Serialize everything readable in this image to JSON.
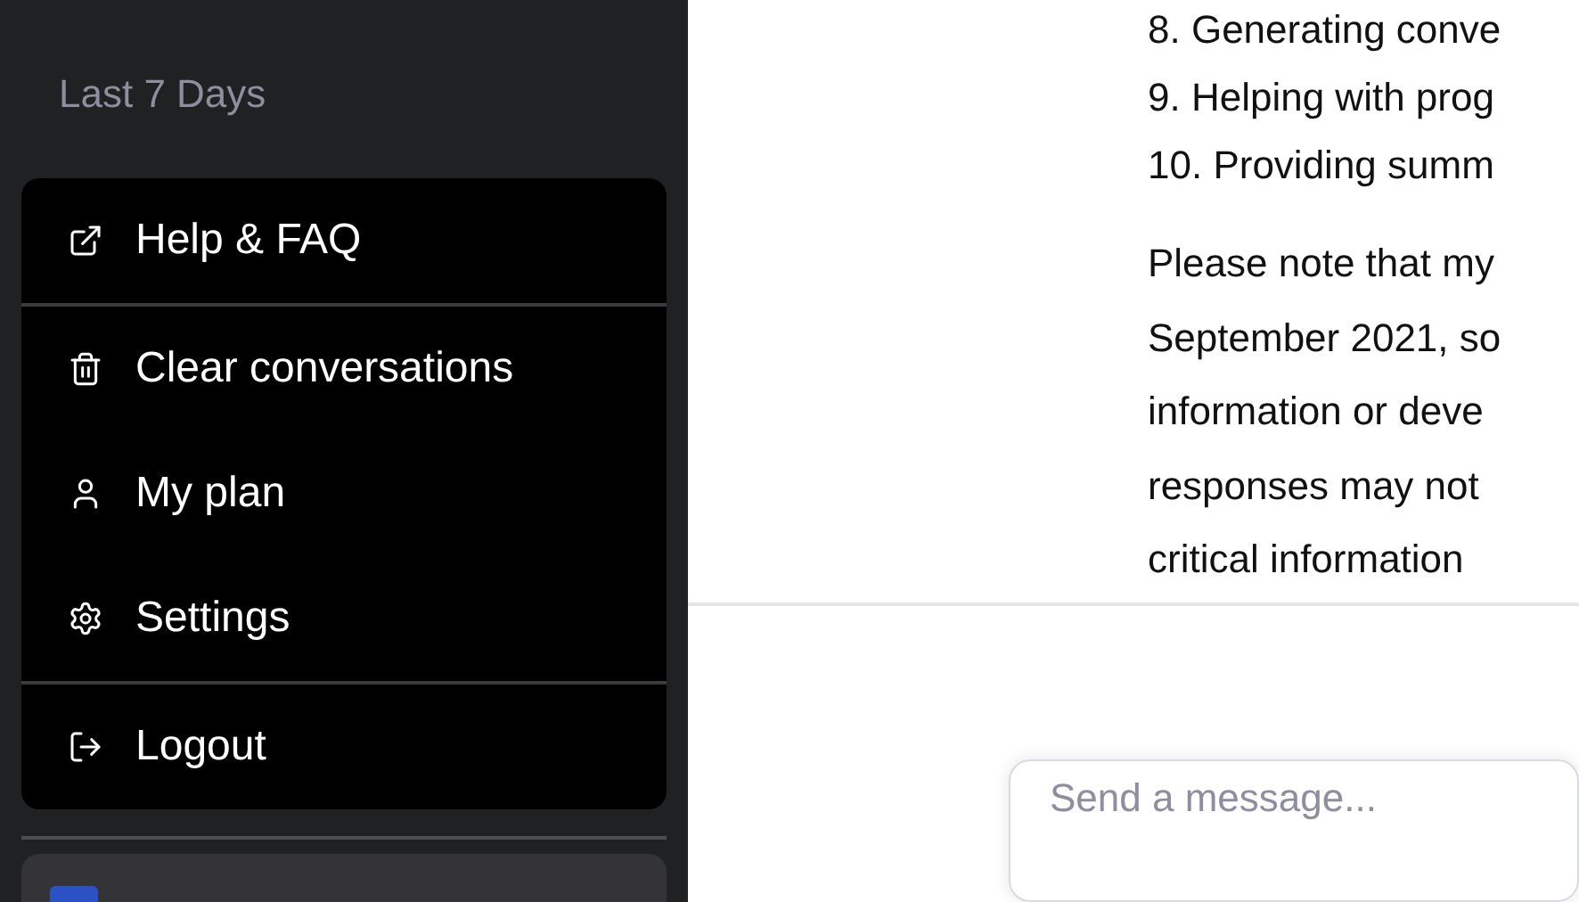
{
  "sidebar": {
    "section_title": "Last 7 Days",
    "menu": {
      "sections": [
        [
          {
            "label": "Help & FAQ"
          }
        ],
        [
          {
            "label": "Clear conversations"
          },
          {
            "label": "My plan"
          },
          {
            "label": "Settings"
          }
        ],
        [
          {
            "label": "Logout"
          }
        ]
      ]
    }
  },
  "chat": {
    "list_lines": [
      "8. Generating conve",
      "9. Helping with prog",
      "10. Providing summ"
    ],
    "paragraph_lines": [
      "Please note that my",
      "September 2021, so",
      "information or deve",
      "responses may not",
      "critical information"
    ]
  },
  "composer": {
    "placeholder": "Send a message..."
  }
}
